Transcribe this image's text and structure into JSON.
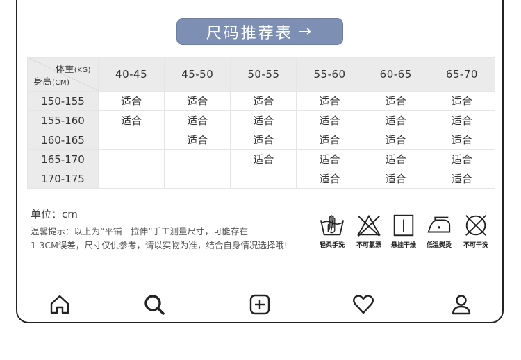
{
  "title": {
    "label": "尺码推荐表",
    "arrow": "→"
  },
  "table": {
    "corner_weight": "体重",
    "corner_weight_unit": "(KG)",
    "corner_height": "身高",
    "corner_height_unit": "(CM)",
    "weight_columns": [
      "40-45",
      "45-50",
      "50-55",
      "55-60",
      "60-65",
      "65-70"
    ],
    "rows": [
      {
        "height": "150-155",
        "cells": [
          "适合",
          "适合",
          "适合",
          "适合",
          "适合",
          "适合"
        ]
      },
      {
        "height": "155-160",
        "cells": [
          "适合",
          "适合",
          "适合",
          "适合",
          "适合",
          "适合"
        ]
      },
      {
        "height": "160-165",
        "cells": [
          "",
          "适合",
          "适合",
          "适合",
          "适合",
          "适合"
        ]
      },
      {
        "height": "165-170",
        "cells": [
          "",
          "",
          "适合",
          "适合",
          "适合",
          "适合"
        ]
      },
      {
        "height": "170-175",
        "cells": [
          "",
          "",
          "",
          "适合",
          "适合",
          "适合"
        ]
      }
    ]
  },
  "unit_text": "单位：cm",
  "tip_line1": "温馨提示：以上为“平铺—拉伸”手工测量尺寸，可能存在",
  "tip_line2": "1-3CM误差，尺寸仅供参考，请以实物为准，结合自身情况选择哦!",
  "care": [
    {
      "icon": "hand-wash-icon",
      "label": "轻柔手洗"
    },
    {
      "icon": "no-bleach-icon",
      "label": "不可氯漂"
    },
    {
      "icon": "hang-dry-icon",
      "label": "悬挂干燥"
    },
    {
      "icon": "low-iron-icon",
      "label": "低温熨烫"
    },
    {
      "icon": "no-dry-clean-icon",
      "label": "不可干洗"
    }
  ],
  "nav": [
    "home-icon",
    "search-icon",
    "add-icon",
    "heart-icon",
    "profile-icon"
  ]
}
